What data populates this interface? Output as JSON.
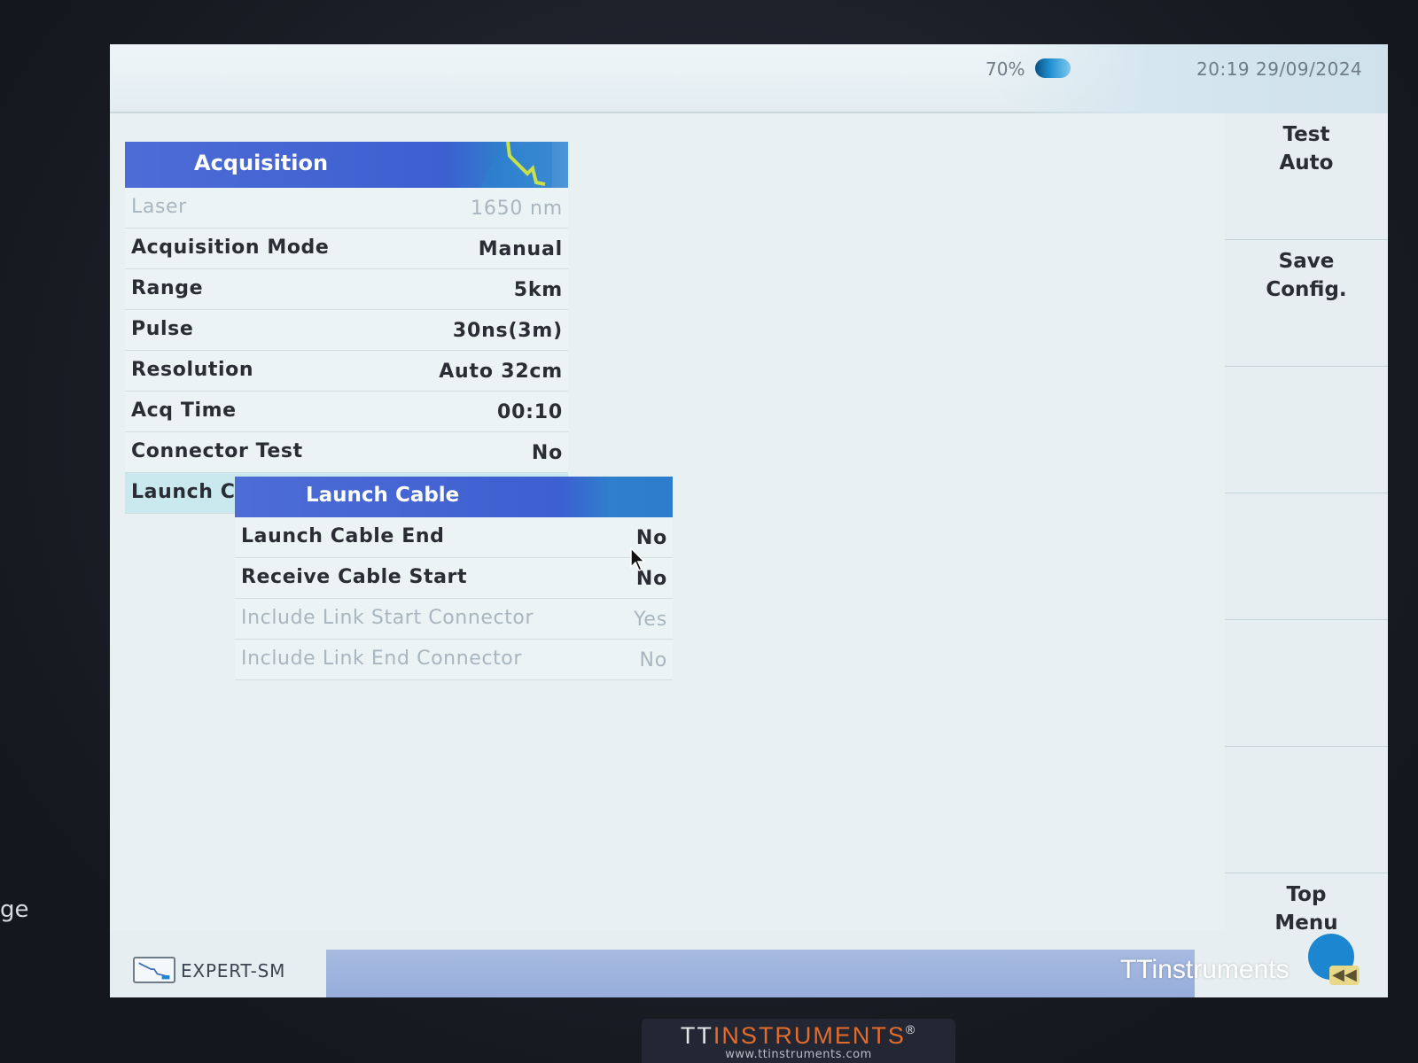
{
  "bezel": {
    "left_edge_text": "ge"
  },
  "status": {
    "battery": "70%",
    "clock": "20:19  29/09/2024"
  },
  "softkeys": [
    {
      "label": "Test\nAuto"
    },
    {
      "label": "Save\nConfig."
    },
    {
      "label": ""
    },
    {
      "label": ""
    },
    {
      "label": ""
    },
    {
      "label": ""
    },
    {
      "label": "Top\nMenu"
    }
  ],
  "menu": {
    "title": "Acquisition",
    "rows": [
      {
        "label": "Laser",
        "value": "1650 nm",
        "state": "disabled"
      },
      {
        "label": "Acquisition Mode",
        "value": "Manual",
        "state": "normal"
      },
      {
        "label": "Range",
        "value": "5km",
        "state": "normal"
      },
      {
        "label": "Pulse",
        "value": "30ns(3m)",
        "state": "normal"
      },
      {
        "label": "Resolution",
        "value": "Auto 32cm",
        "state": "normal"
      },
      {
        "label": "Acq Time",
        "value": "00:10",
        "state": "normal"
      },
      {
        "label": "Connector Test",
        "value": "No",
        "state": "normal"
      },
      {
        "label": "Launch C",
        "value": "",
        "state": "selected"
      }
    ]
  },
  "submenu": {
    "title": "Launch Cable",
    "rows": [
      {
        "label": "Launch Cable End",
        "value": "No",
        "state": "normal"
      },
      {
        "label": "Receive Cable Start",
        "value": "No",
        "state": "normal"
      },
      {
        "label": "Include Link Start Connector",
        "value": "Yes",
        "state": "disabled"
      },
      {
        "label": "Include Link End Connector",
        "value": "No",
        "state": "disabled"
      }
    ]
  },
  "bottom": {
    "mode": "EXPERT-SM",
    "brand": "TTinstruments"
  },
  "logo": {
    "prefix": "TT",
    "name": "INSTRUMENTS",
    "mark": "®",
    "url": "www.ttinstruments.com"
  },
  "colors": {
    "header_blue": "#3d5fd0",
    "selected_row": "#c9e9ee",
    "screen_bg": "#e8f0f2",
    "logo_accent": "#e56b2a"
  }
}
